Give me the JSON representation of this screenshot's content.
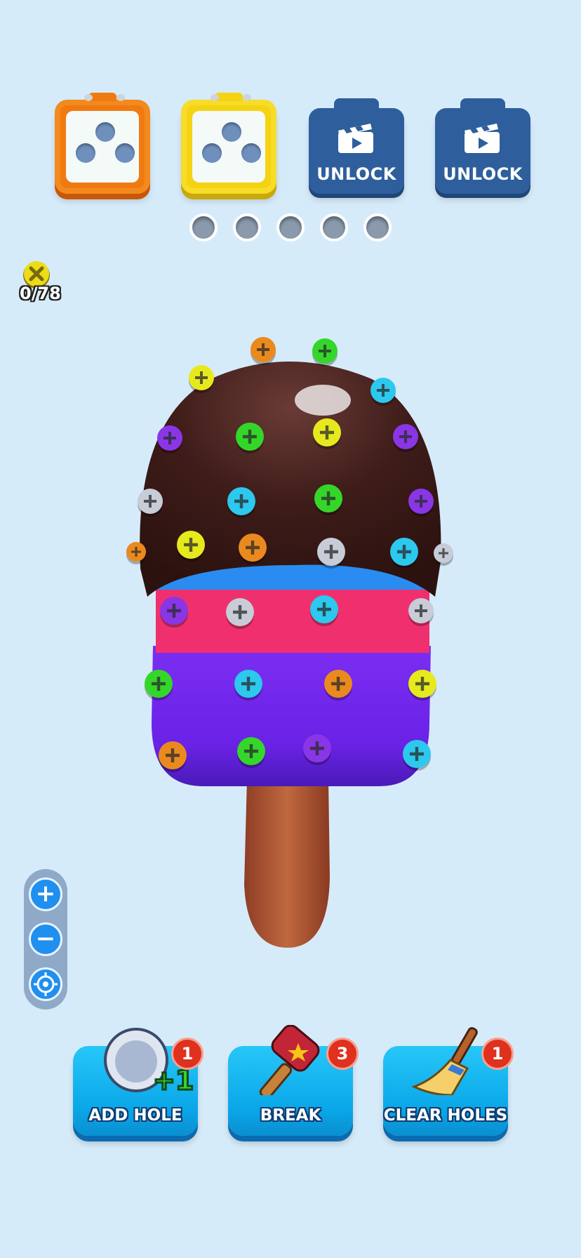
{
  "boxes": [
    {
      "type": "open",
      "color": "#f07a12",
      "name": "orange"
    },
    {
      "type": "open",
      "color": "#f5d313",
      "name": "yellow"
    },
    {
      "type": "locked",
      "label": "UNLOCK"
    },
    {
      "type": "locked",
      "label": "UNLOCK"
    }
  ],
  "progress_dots": 5,
  "screw_counter": {
    "text": "0/78",
    "icon": "screw-icon"
  },
  "zoom": {
    "plus": "+",
    "minus": "−",
    "recenter_icon": "target-icon"
  },
  "boosters": [
    {
      "label": "ADD HOLE",
      "badge": "1",
      "icon": "hole-plus-one-icon",
      "icon_text": "+1"
    },
    {
      "label": "BREAK",
      "badge": "3",
      "icon": "hammer-icon"
    },
    {
      "label": "CLEAR HOLES",
      "badge": "1",
      "icon": "broom-icon"
    }
  ],
  "scene": {
    "object": "popsicle",
    "colors": {
      "chocolate": "#3b1a18",
      "blue_band": "#2a8cf0",
      "pink_band": "#f0306e",
      "purple_band": "#7a2ef0",
      "stick": "#b0573a"
    },
    "screw_colors": {
      "purple": "#8a36e6",
      "green": "#35d62a",
      "yellow": "#e6ea1c",
      "cyan": "#2cc8ee",
      "gray": "#c7ccd6",
      "orange": "#ea8a1e"
    }
  }
}
